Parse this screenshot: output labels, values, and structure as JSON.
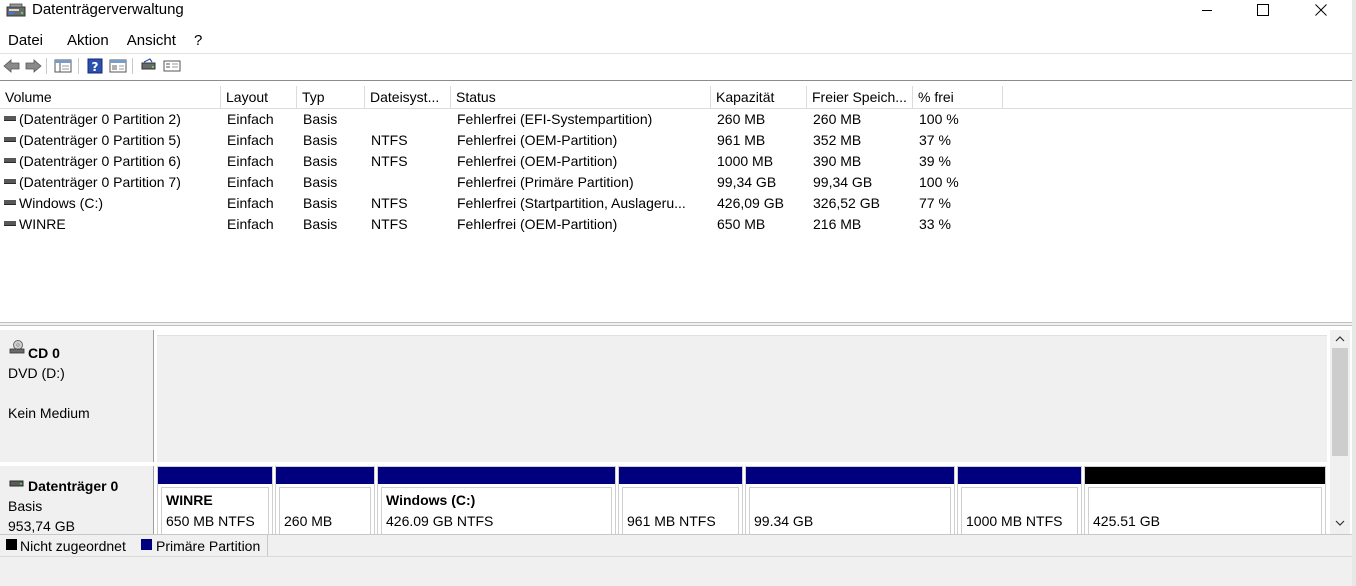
{
  "window": {
    "title": "Datenträgerverwaltung",
    "icon": "disk-management-icon"
  },
  "menu": [
    "Datei",
    "Aktion",
    "Ansicht",
    "?"
  ],
  "toolbar": [
    "back-icon",
    "forward-icon",
    "console-tree-icon",
    "help-icon",
    "properties-icon",
    "rescan-icon",
    "connect-icon"
  ],
  "volume_list": {
    "columns": [
      "Volume",
      "Layout",
      "Typ",
      "Dateisyst...",
      "Status",
      "Kapazität",
      "Freier Speich...",
      "% frei"
    ],
    "rows": [
      {
        "volume": "(Datenträger 0 Partition 2)",
        "layout": "Einfach",
        "typ": "Basis",
        "fs": "",
        "status": "Fehlerfrei (EFI-Systempartition)",
        "kapazitaet": "260 MB",
        "frei": "260 MB",
        "prozent": "100 %"
      },
      {
        "volume": "(Datenträger 0 Partition 5)",
        "layout": "Einfach",
        "typ": "Basis",
        "fs": "NTFS",
        "status": "Fehlerfrei (OEM-Partition)",
        "kapazitaet": "961 MB",
        "frei": "352 MB",
        "prozent": "37 %"
      },
      {
        "volume": "(Datenträger 0 Partition 6)",
        "layout": "Einfach",
        "typ": "Basis",
        "fs": "NTFS",
        "status": "Fehlerfrei (OEM-Partition)",
        "kapazitaet": "1000 MB",
        "frei": "390 MB",
        "prozent": "39 %"
      },
      {
        "volume": "(Datenträger 0 Partition 7)",
        "layout": "Einfach",
        "typ": "Basis",
        "fs": "",
        "status": "Fehlerfrei (Primäre Partition)",
        "kapazitaet": "99,34 GB",
        "frei": "99,34 GB",
        "prozent": "100 %"
      },
      {
        "volume": "Windows (C:)",
        "layout": "Einfach",
        "typ": "Basis",
        "fs": "NTFS",
        "status": "Fehlerfrei (Startpartition, Auslageru...",
        "kapazitaet": "426,09 GB",
        "frei": "326,52 GB",
        "prozent": "77 %"
      },
      {
        "volume": "WINRE",
        "layout": "Einfach",
        "typ": "Basis",
        "fs": "NTFS",
        "status": "Fehlerfrei (OEM-Partition)",
        "kapazitaet": "650 MB",
        "frei": "216 MB",
        "prozent": "33 %"
      }
    ]
  },
  "cd0": {
    "title": "CD 0",
    "line1": "DVD (D:)",
    "line2": "Kein Medium"
  },
  "disk0": {
    "title": "Datenträger 0",
    "line1": "Basis",
    "line2": "953,74 GB",
    "partitions": [
      {
        "name": "WINRE",
        "size": "650 MB NTFS",
        "bar": "primary"
      },
      {
        "name": "",
        "size": "260 MB",
        "bar": "primary"
      },
      {
        "name": "Windows  (C:)",
        "size": "426.09 GB NTFS",
        "bar": "primary"
      },
      {
        "name": "",
        "size": "961 MB NTFS",
        "bar": "primary"
      },
      {
        "name": "",
        "size": "99.34 GB",
        "bar": "primary"
      },
      {
        "name": "",
        "size": "1000 MB NTFS",
        "bar": "primary"
      },
      {
        "name": "",
        "size": "425.51 GB",
        "bar": "unallocated"
      }
    ]
  },
  "legend": {
    "unallocated": "Nicht zugeordnet",
    "primary": "Primäre Partition",
    "unallocated_color": "#000000",
    "primary_color": "#00007f"
  }
}
